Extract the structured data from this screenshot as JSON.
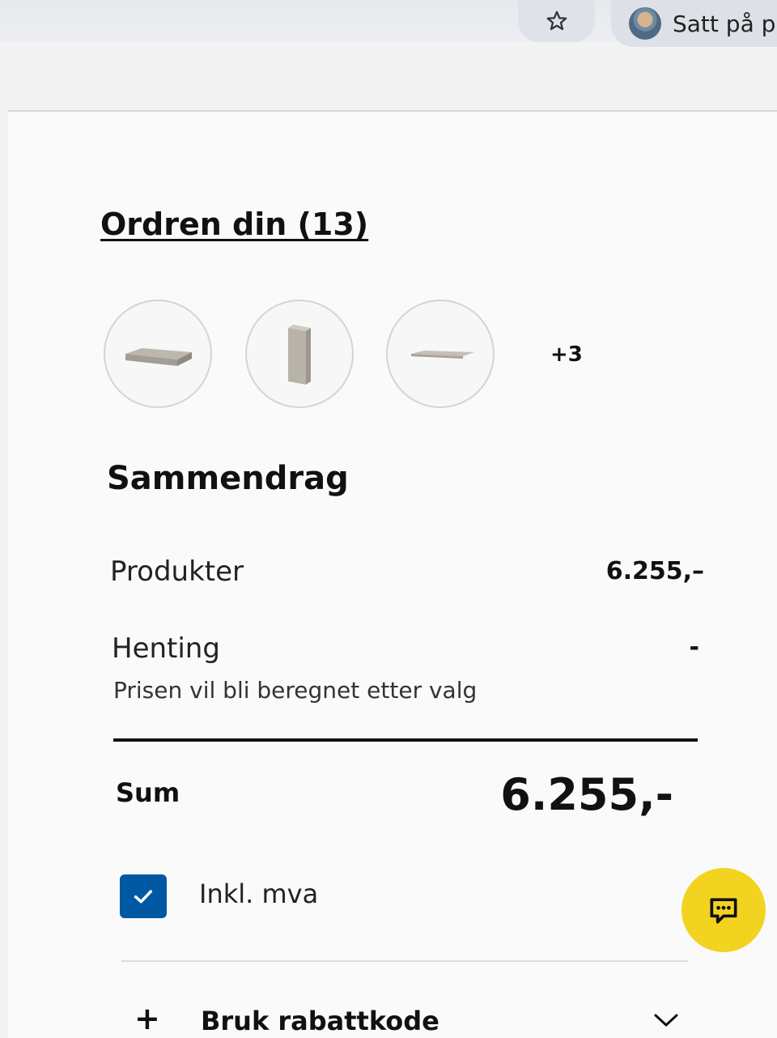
{
  "browser": {
    "profile_label": "Satt på pa"
  },
  "order": {
    "title": "Ordren din (13)",
    "more_count": "+3"
  },
  "summary": {
    "heading": "Sammendrag",
    "products_label": "Produkter",
    "products_value": "6.255,–",
    "pickup_label": "Henting",
    "pickup_value": "-",
    "pickup_note": "Prisen vil bli beregnet etter valg",
    "total_label": "Sum",
    "total_value": "6.255,-"
  },
  "vat": {
    "label": "Inkl. mva",
    "checked": true
  },
  "discount": {
    "label": "Bruk rabattkode"
  },
  "colors": {
    "accent_blue": "#0058a3",
    "chat_yellow": "#f2d320"
  }
}
